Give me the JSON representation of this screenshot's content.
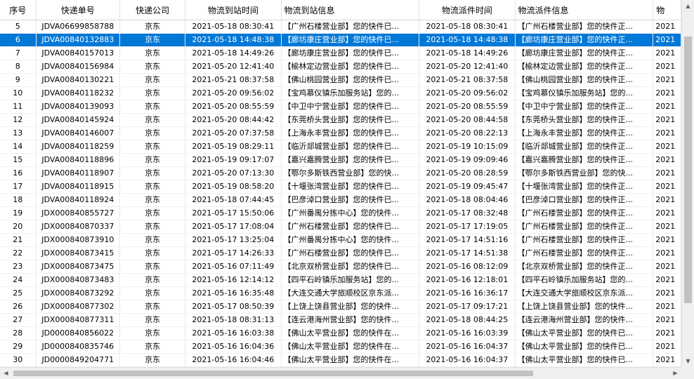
{
  "table": {
    "columns": [
      {
        "key": "seq",
        "label": "序号",
        "align": "c"
      },
      {
        "key": "tracking_no",
        "label": "快递单号",
        "align": "c"
      },
      {
        "key": "company",
        "label": "快递公司",
        "align": "c"
      },
      {
        "key": "arrival_time",
        "label": "物流到站时间",
        "align": "c"
      },
      {
        "key": "arrival_info",
        "label": "物流到站信息",
        "align": "l"
      },
      {
        "key": "dispatch_time",
        "label": "物流派件时间",
        "align": "c"
      },
      {
        "key": "dispatch_info",
        "label": "物流派件信息",
        "align": "l"
      },
      {
        "key": "extra",
        "label": "物",
        "align": "l"
      }
    ],
    "rows": [
      {
        "seq": "5",
        "tracking_no": "JDVA06699858788",
        "company": "京东",
        "arrival_time": "2021-05-18 08:30:41",
        "arrival_info": "【广州石楼营业部】您的快件已...",
        "dispatch_time": "2021-05-18 08:30:41",
        "dispatch_info": "【广州石楼营业部】您的快件正...",
        "extra": "2021",
        "selected": false
      },
      {
        "seq": "6",
        "tracking_no": "JDVA00840132883",
        "company": "京东",
        "arrival_time": "2021-05-18 14:48:38",
        "arrival_info": "【廊坊康庄营业部】您的快件已...",
        "dispatch_time": "2021-05-18 14:48:38",
        "dispatch_info": "【廊坊康庄营业部】您的快件正...",
        "extra": "2021",
        "selected": true
      },
      {
        "seq": "7",
        "tracking_no": "JDVA00840157013",
        "company": "京东",
        "arrival_time": "2021-05-18 14:49:26",
        "arrival_info": "【廊坊康庄营业部】您的快件已...",
        "dispatch_time": "2021-05-18 14:49:26",
        "dispatch_info": "【廊坊康庄营业部】您的快件正...",
        "extra": "2021",
        "selected": false
      },
      {
        "seq": "8",
        "tracking_no": "JDVA00840156984",
        "company": "京东",
        "arrival_time": "2021-05-20 12:41:40",
        "arrival_info": "【榆林定边营业部】您的快件已...",
        "dispatch_time": "2021-05-20 12:41:40",
        "dispatch_info": "【榆林定边营业部】您的快件正...",
        "extra": "2021",
        "selected": false
      },
      {
        "seq": "9",
        "tracking_no": "JDVA00840130221",
        "company": "京东",
        "arrival_time": "2021-05-21 08:37:58",
        "arrival_info": "【佛山桃园营业部】您的快件已...",
        "dispatch_time": "2021-05-21 08:37:58",
        "dispatch_info": "【佛山桃园营业部】您的快件正...",
        "extra": "2021",
        "selected": false
      },
      {
        "seq": "10",
        "tracking_no": "JDVA00840118232",
        "company": "京东",
        "arrival_time": "2021-05-20 09:56:02",
        "arrival_info": "【宝鸡慕仪镇乐加服务站】您的...",
        "dispatch_time": "2021-05-20 09:56:02",
        "dispatch_info": "【宝鸡慕仪镇乐加服务站】您的...",
        "extra": "2021",
        "selected": false
      },
      {
        "seq": "11",
        "tracking_no": "JDVA00840139093",
        "company": "京东",
        "arrival_time": "2021-05-20 08:55:59",
        "arrival_info": "【中卫中宁营业部】您的快件已...",
        "dispatch_time": "2021-05-20 08:55:59",
        "dispatch_info": "【中卫中宁营业部】您的快件正...",
        "extra": "2021",
        "selected": false
      },
      {
        "seq": "12",
        "tracking_no": "JDVA00840145924",
        "company": "京东",
        "arrival_time": "2021-05-20 08:44:42",
        "arrival_info": "【东莞桥头营业部】您的快件已...",
        "dispatch_time": "2021-05-20 08:44:58",
        "dispatch_info": "【东莞桥头营业部】您的快件正...",
        "extra": "2021",
        "selected": false
      },
      {
        "seq": "13",
        "tracking_no": "JDVA00840146007",
        "company": "京东",
        "arrival_time": "2021-05-20 07:37:58",
        "arrival_info": "【上海永丰营业部】您的快件已...",
        "dispatch_time": "2021-05-20 08:22:13",
        "dispatch_info": "【上海永丰营业部】您的快件正...",
        "extra": "2021",
        "selected": false
      },
      {
        "seq": "14",
        "tracking_no": "JDVA00840118259",
        "company": "京东",
        "arrival_time": "2021-05-19 08:29:11",
        "arrival_info": "【临沂郯城营业部】您的快件已...",
        "dispatch_time": "2021-05-19 10:15:09",
        "dispatch_info": "【临沂郯城营业部】您的快件正...",
        "extra": "2021",
        "selected": false
      },
      {
        "seq": "15",
        "tracking_no": "JDVA00840118896",
        "company": "京东",
        "arrival_time": "2021-05-19 09:17:07",
        "arrival_info": "【嘉兴嘉腾营业部】您的快件已...",
        "dispatch_time": "2021-05-19 09:09:46",
        "dispatch_info": "【嘉兴嘉腾营业部】您的快件正...",
        "extra": "2021",
        "selected": false
      },
      {
        "seq": "16",
        "tracking_no": "JDVA00840118907",
        "company": "京东",
        "arrival_time": "2021-05-20 07:13:30",
        "arrival_info": "【鄂尔多斯铁西营业部】您的快...",
        "dispatch_time": "2021-05-20 08:28:59",
        "dispatch_info": "【鄂尔多斯铁西营业部】您的快...",
        "extra": "2021",
        "selected": false
      },
      {
        "seq": "17",
        "tracking_no": "JDVA00840118915",
        "company": "京东",
        "arrival_time": "2021-05-19 08:58:20",
        "arrival_info": "【十堰张湾营业部】您的快件已...",
        "dispatch_time": "2021-05-19 09:45:47",
        "dispatch_info": "【十堰张湾营业部】您的快件正...",
        "extra": "2021",
        "selected": false
      },
      {
        "seq": "18",
        "tracking_no": "JDVA00840118924",
        "company": "京东",
        "arrival_time": "2021-05-18 07:44:45",
        "arrival_info": "【巴彦淖口营业部】您的快件已...",
        "dispatch_time": "2021-05-18 08:04:46",
        "dispatch_info": "【巴彦淖口营业部】您的快件正...",
        "extra": "2021",
        "selected": false
      },
      {
        "seq": "19",
        "tracking_no": "JDX000840855727",
        "company": "京东",
        "arrival_time": "2021-05-17 15:50:06",
        "arrival_info": "【广州番禺分拣中心】您的快件...",
        "dispatch_time": "2021-05-17 08:32:48",
        "dispatch_info": "【广州石楼营业部】您的快件正...",
        "extra": "2021",
        "selected": false
      },
      {
        "seq": "20",
        "tracking_no": "JDX000840870337",
        "company": "京东",
        "arrival_time": "2021-05-17 17:08:04",
        "arrival_info": "【广州石楼营业部】您的快件已...",
        "dispatch_time": "2021-05-17 17:19:05",
        "dispatch_info": "【广州石楼营业部】您的快件正...",
        "extra": "2021",
        "selected": false
      },
      {
        "seq": "21",
        "tracking_no": "JDX000840873910",
        "company": "京东",
        "arrival_time": "2021-05-17 13:25:04",
        "arrival_info": "【广州番禺分拣中心】您的快件...",
        "dispatch_time": "2021-05-17 14:51:16",
        "dispatch_info": "【广州石楼营业部】您的快件正...",
        "extra": "2021",
        "selected": false
      },
      {
        "seq": "22",
        "tracking_no": "JDX000840873415",
        "company": "京东",
        "arrival_time": "2021-05-17 14:26:33",
        "arrival_info": "【广州石楼营业部】您的快件已...",
        "dispatch_time": "2021-05-17 14:51:38",
        "dispatch_info": "【广州石楼营业部】您的快件正...",
        "extra": "2021",
        "selected": false
      },
      {
        "seq": "23",
        "tracking_no": "JDX000840873475",
        "company": "京东",
        "arrival_time": "2021-05-16 07:11:49",
        "arrival_info": "【北京双桥营业部】您的快件已...",
        "dispatch_time": "2021-05-16 08:12:09",
        "dispatch_info": "【北京双桥营业部】您的快件正...",
        "extra": "2021",
        "selected": false
      },
      {
        "seq": "24",
        "tracking_no": "JDX000840873483",
        "company": "京东",
        "arrival_time": "2021-05-16 12:14:12",
        "arrival_info": "【四平石岭镇乐加服务站】您的...",
        "dispatch_time": "2021-05-16 12:18:01",
        "dispatch_info": "【四平石岭镇乐加服务站】您的...",
        "extra": "2021",
        "selected": false
      },
      {
        "seq": "25",
        "tracking_no": "JDX000840873292",
        "company": "京东",
        "arrival_time": "2021-05-16 16:35:48",
        "arrival_info": "【大连交通大学旅顺校区京东派...",
        "dispatch_time": "2021-05-16 16:36:17",
        "dispatch_info": "【大连交通大学旅顺校区京东派...",
        "extra": "2021",
        "selected": false
      },
      {
        "seq": "26",
        "tracking_no": "JDX000840877302",
        "company": "京东",
        "arrival_time": "2021-05-17 08:50:39",
        "arrival_info": "【上饶上饶县营业部】您的快件...",
        "dispatch_time": "2021-05-17 09:17:21",
        "dispatch_info": "【上饶上饶县营业部】您的快件...",
        "extra": "2021",
        "selected": false
      },
      {
        "seq": "27",
        "tracking_no": "JDX000840877311",
        "company": "京东",
        "arrival_time": "2021-05-18 08:31:13",
        "arrival_info": "【连云港海州营业部】您的快件...",
        "dispatch_time": "2021-05-18 08:44:25",
        "dispatch_info": "【连云港海州营业部】您的快件...",
        "extra": "2021",
        "selected": false
      },
      {
        "seq": "28",
        "tracking_no": "JD0000840856022",
        "company": "京东",
        "arrival_time": "2021-05-16 16:03:38",
        "arrival_info": "【佛山太平营业部】您的快件在...",
        "dispatch_time": "2021-05-16 16:03:39",
        "dispatch_info": "【佛山太平营业部】您的快件已...",
        "extra": "2021",
        "selected": false
      },
      {
        "seq": "29",
        "tracking_no": "JD0000840835746",
        "company": "京东",
        "arrival_time": "2021-05-16 16:04:36",
        "arrival_info": "【佛山太平营业部】您的快件在...",
        "dispatch_time": "2021-05-16 16:04:37",
        "dispatch_info": "【佛山太平营业部】您的快件已...",
        "extra": "2021",
        "selected": false
      },
      {
        "seq": "30",
        "tracking_no": "JD0000849204771",
        "company": "京东",
        "arrival_time": "2021-05-16 16:04:46",
        "arrival_info": "【佛山太平营业部】您的快件在...",
        "dispatch_time": "2021-05-16 16:04:37",
        "dispatch_info": "【佛山太平营业部】您的快件已...",
        "extra": "2021",
        "selected": false
      }
    ]
  },
  "scrollbars": {
    "up_arrow": "▲",
    "down_arrow": "▼",
    "left_arrow": "◀",
    "right_arrow": "▶"
  },
  "colors": {
    "selection": "#0078d7",
    "selection_text": "#ffffff"
  }
}
